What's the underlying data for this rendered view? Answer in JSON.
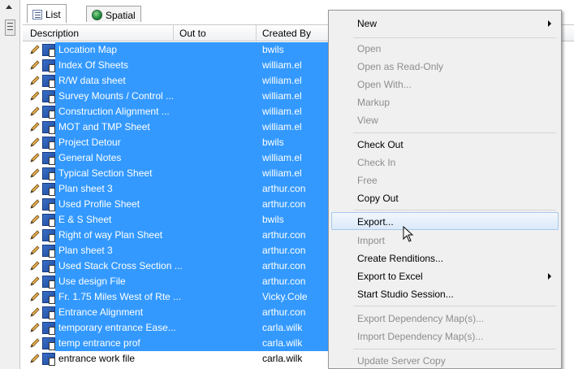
{
  "tabs": [
    {
      "label": "List",
      "active": true
    },
    {
      "label": "Spatial",
      "active": false
    }
  ],
  "columns": [
    "Description",
    "Out to",
    "Created By"
  ],
  "rows": [
    {
      "description": "Location Map",
      "created_by": "bwils",
      "selected": true
    },
    {
      "description": "Index Of Sheets",
      "created_by": "william.el",
      "selected": true
    },
    {
      "description": "R/W data sheet",
      "created_by": "william.el",
      "selected": true
    },
    {
      "description": "Survey Mounts / Control ...",
      "created_by": "william.el",
      "selected": true
    },
    {
      "description": "Construction Alignment ...",
      "created_by": "william.el",
      "selected": true
    },
    {
      "description": "MOT and TMP Sheet",
      "created_by": "william.el",
      "selected": true
    },
    {
      "description": "Project Detour",
      "created_by": "bwils",
      "selected": true
    },
    {
      "description": "General Notes",
      "created_by": "william.el",
      "selected": true
    },
    {
      "description": "Typical Section Sheet",
      "created_by": "william.el",
      "selected": true
    },
    {
      "description": "Plan sheet 3",
      "created_by": "arthur.con",
      "selected": true
    },
    {
      "description": "Used Profile Sheet",
      "created_by": "arthur.con",
      "selected": true
    },
    {
      "description": "E & S Sheet",
      "created_by": "bwils",
      "selected": true
    },
    {
      "description": "Right of way Plan Sheet",
      "created_by": "arthur.con",
      "selected": true
    },
    {
      "description": "Plan sheet 3",
      "created_by": "arthur.con",
      "selected": true
    },
    {
      "description": "Used Stack Cross Section ...",
      "created_by": "arthur.con",
      "selected": true
    },
    {
      "description": "Use     design File",
      "created_by": "arthur.con",
      "selected": true
    },
    {
      "description": "Fr. 1.75 Miles West of Rte ...",
      "created_by": "Vicky.Cole",
      "selected": true
    },
    {
      "description": "Entrance Alignment",
      "created_by": "arthur.con",
      "selected": true
    },
    {
      "description": "temporary entrance Ease...",
      "created_by": "carla.wilk",
      "selected": true
    },
    {
      "description": "temp entrance prof",
      "created_by": "carla.wilk",
      "selected": true
    },
    {
      "description": "entrance work file",
      "created_by": "carla.wilk",
      "selected": false
    }
  ],
  "context_menu": {
    "new": "New",
    "open": "Open",
    "open_read_only": "Open as Read-Only",
    "open_with": "Open With...",
    "markup": "Markup",
    "view": "View",
    "check_out": "Check Out",
    "check_in": "Check In",
    "free": "Free",
    "copy_out": "Copy Out",
    "export": "Export...",
    "import": "Import",
    "create_renditions": "Create Renditions...",
    "export_to_excel": "Export to Excel",
    "start_studio_session": "Start Studio Session...",
    "export_dependency_maps": "Export Dependency Map(s)...",
    "import_dependency_maps": "Import Dependency Map(s)...",
    "update_server_copy": "Update Server Copy"
  },
  "colors": {
    "selection": "#3399ff",
    "menu_bg": "#f0f0f0",
    "disabled_text": "#8d8d8d"
  }
}
